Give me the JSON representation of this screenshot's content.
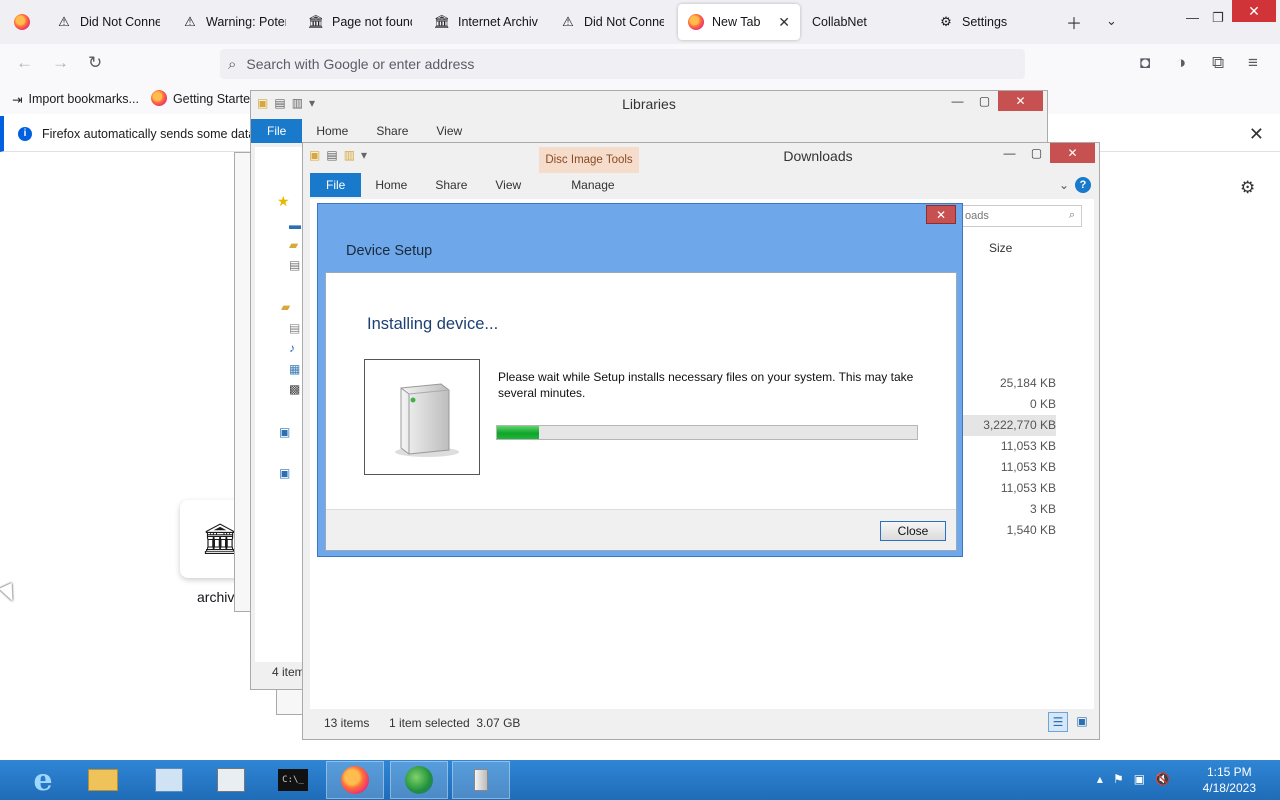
{
  "browser": {
    "tabs": [
      {
        "label": "",
        "icon": "firefox-logo-icon"
      },
      {
        "label": "Did Not Conne",
        "icon": "warning-icon"
      },
      {
        "label": "Warning: Poten",
        "icon": "warning-icon"
      },
      {
        "label": "Page not found",
        "icon": "archive-icon"
      },
      {
        "label": "Internet Archive",
        "icon": "archive-icon"
      },
      {
        "label": "Did Not Conne",
        "icon": "warning-icon"
      },
      {
        "label": "New Tab",
        "icon": "firefox-logo-icon",
        "active": true
      },
      {
        "label": "CollabNet",
        "icon": ""
      },
      {
        "label": "Settings",
        "icon": "gear-icon"
      }
    ],
    "urlbar_placeholder": "Search with Google or enter address",
    "bookmarks": [
      "Import bookmarks...",
      "Getting Started"
    ],
    "notification": "Firefox automatically sends some data t",
    "shortcut_label": "archiv"
  },
  "libraries_window": {
    "title": "Libraries",
    "tabs": [
      "File",
      "Home",
      "Share",
      "View"
    ],
    "status": "4 item"
  },
  "downloads_window": {
    "title": "Downloads",
    "context_tab_group": "Disc Image Tools",
    "tabs": [
      "File",
      "Home",
      "Share",
      "View",
      "Manage"
    ],
    "search_text": "oads",
    "column_size": "Size",
    "sizes": [
      "25,184 KB",
      "0 KB",
      "3,222,770 KB",
      "11,053 KB",
      "11,053 KB",
      "11,053 KB",
      "3 KB",
      "1,540 KB"
    ],
    "status_items": "13 items",
    "status_selected": "1 item selected  3.07 GB"
  },
  "dialog": {
    "title": "Device Setup",
    "heading": "Installing device...",
    "message": "Please wait while Setup installs necessary files on your system. This may take several minutes.",
    "progress": 0.1,
    "close_button": "Close"
  },
  "taskbar": {
    "time": "1:15 PM",
    "date": "4/18/2023"
  },
  "colors": {
    "dialog_frame": "#6ea7ea",
    "ribbon_file": "#1979ca",
    "taskbar": "#2579c7",
    "close_red": "#c75050",
    "progress_green": "#0fa52a"
  }
}
